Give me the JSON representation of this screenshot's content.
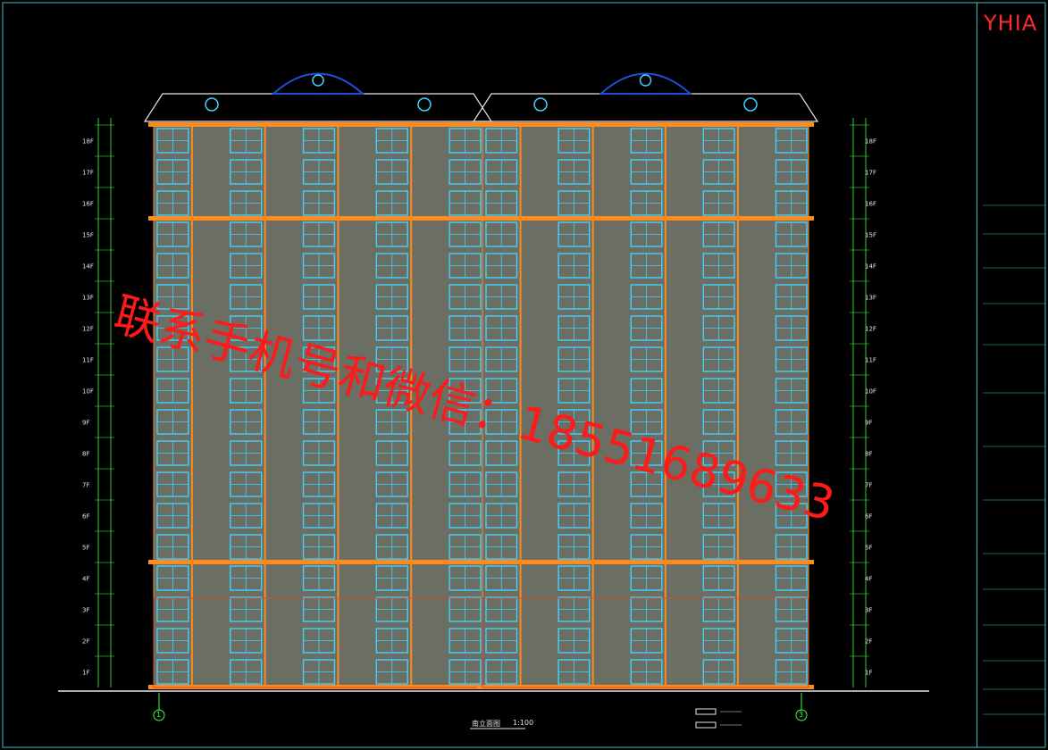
{
  "drawing": {
    "brand": "YHIA",
    "watermark": "联系手机号和微信：18551689633",
    "caption": "南立面图",
    "scale": "1:100",
    "axis_left": "1",
    "axis_right": "3",
    "floor_labels": [
      "18F",
      "17F",
      "16F",
      "15F",
      "14F",
      "13F",
      "12F",
      "11F",
      "10F",
      "9F",
      "8F",
      "7F",
      "6F",
      "5F",
      "4F",
      "3F",
      "2F",
      "1F"
    ]
  },
  "colors": {
    "background": "#000000",
    "wall": "#6a6e63",
    "window": "#3fd2ff",
    "trim": "#ff8a1e",
    "frame": "#3fbfbf",
    "dim": "#3cff3c",
    "text": "#e6e6e6",
    "watermark": "#ff1a1a",
    "roof": "#1e4fd8"
  },
  "icons": [
    "axis-bubble-icon",
    "elevation-symbol-icon",
    "roof-dormer-icon"
  ]
}
